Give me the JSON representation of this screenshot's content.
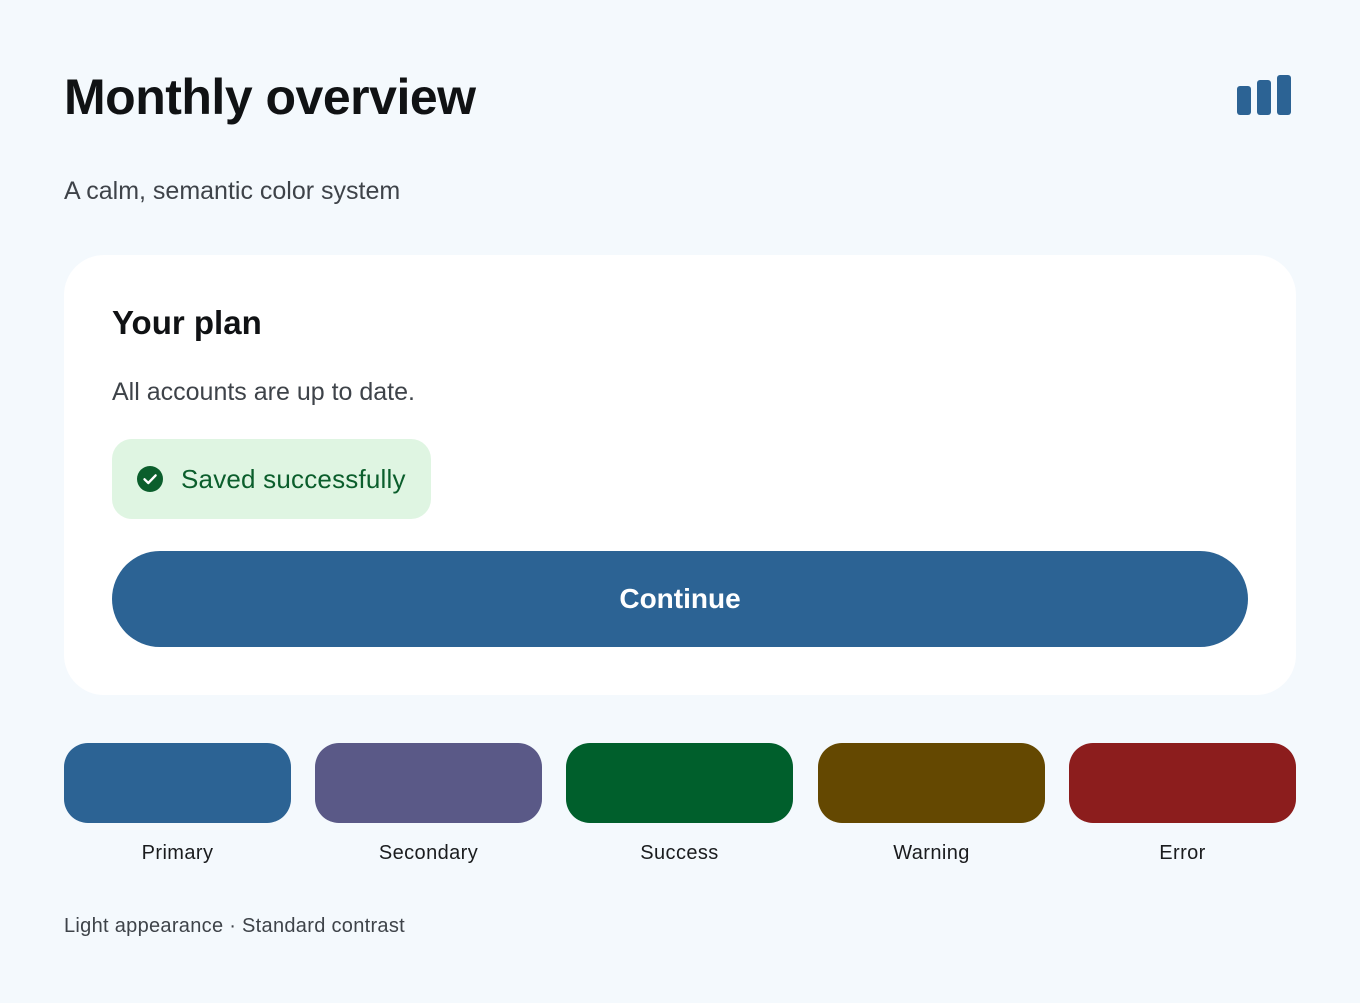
{
  "header": {
    "title": "Monthly overview",
    "icon": "bar-chart-icon",
    "subtitle": "A calm, semantic color system"
  },
  "card": {
    "title": "Your plan",
    "text": "All accounts are up to date.",
    "status": {
      "icon": "check-circle-icon",
      "label": "Saved successfully"
    },
    "button_label": "Continue"
  },
  "swatches": [
    {
      "label": "Primary",
      "color": "#2c6394"
    },
    {
      "label": "Secondary",
      "color": "#5a5987"
    },
    {
      "label": "Success",
      "color": "#005f2c"
    },
    {
      "label": "Warning",
      "color": "#644801"
    },
    {
      "label": "Error",
      "color": "#8c1d1d"
    }
  ],
  "footer": {
    "text": "Light appearance · Standard contrast"
  },
  "colors": {
    "background": "#f4f9fd",
    "card": "#ffffff",
    "primary": "#2c6394",
    "success_container": "#dff5e2",
    "on_success_container": "#0b5e2c"
  }
}
